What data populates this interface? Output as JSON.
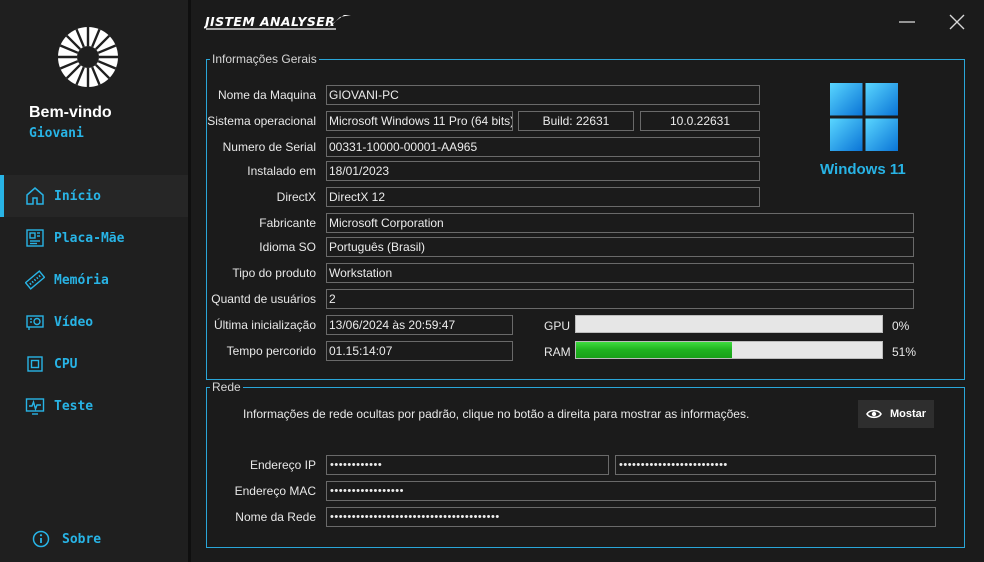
{
  "sidebar": {
    "welcome": "Bem-vindo",
    "username": "Giovani",
    "items": [
      {
        "label": "Início",
        "icon": "home-icon"
      },
      {
        "label": "Placa-Mãe",
        "icon": "motherboard-icon"
      },
      {
        "label": "Memória",
        "icon": "memory-icon"
      },
      {
        "label": "Vídeo",
        "icon": "gpu-icon"
      },
      {
        "label": "CPU",
        "icon": "cpu-icon"
      },
      {
        "label": "Teste",
        "icon": "test-icon"
      }
    ],
    "about_label": "Sobre",
    "accent": "#28b4e6"
  },
  "titlebar": {
    "app_title": "JISTEM ANALYSER"
  },
  "general": {
    "group_title": "Informações Gerais",
    "labels": {
      "machine_name": "Nome da Maquina",
      "os": "Sistema operacional",
      "serial": "Numero de Serial",
      "installed": "Instalado em",
      "directx": "DirectX",
      "manufacturer": "Fabricante",
      "language": "Idioma SO",
      "product_type": "Tipo do produto",
      "user_count": "Quantd de usuários",
      "last_boot": "Última inicialização",
      "uptime": "Tempo percorido",
      "gpu": "GPU",
      "ram": "RAM"
    },
    "values": {
      "machine_name": "GIOVANI-PC",
      "os": "Microsoft Windows 11 Pro (64 bits)",
      "build": "Build: 22631",
      "version": "10.0.22631",
      "serial": "00331-10000-00001-AA965",
      "installed": "18/01/2023",
      "directx": "DirectX 12",
      "manufacturer": "Microsoft Corporation",
      "language": "Português (Brasil)",
      "product_type": "Workstation",
      "user_count": "2",
      "last_boot": "13/06/2024 às 20:59:47",
      "uptime": "01.15:14:07"
    },
    "gpu_usage": 0,
    "gpu_text": "0%",
    "ram_usage": 51,
    "ram_text": "51%",
    "os_brand": "Windows 11",
    "os_brand_color": "#28b4e6"
  },
  "network": {
    "group_title": "Rede",
    "info_text": "Informações de rede ocultas por padrão, clique no botão a direita para mostrar as informações.",
    "show_button": "Mostar",
    "labels": {
      "ip": "Endereço IP",
      "mac": "Endereço MAC",
      "network_name": "Nome da Rede"
    },
    "values": {
      "ipv4": "••••••••••••",
      "ipv6": "•••••••••••••••••••••••••",
      "mac": "•••••••••••••••••",
      "network_name": "•••••••••••••••••••••••••••••••••••••••"
    }
  }
}
